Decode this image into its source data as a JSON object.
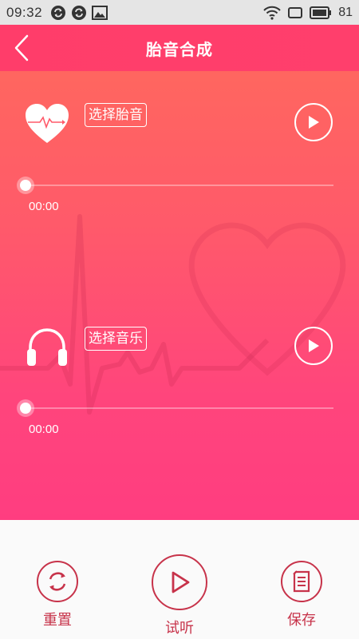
{
  "status_bar": {
    "time": "09:32",
    "battery": "81",
    "icons": [
      "sync-icon",
      "sync-icon",
      "image-icon",
      "wifi-icon",
      "screen-icon",
      "battery-icon"
    ]
  },
  "header": {
    "title": "胎音合成",
    "back_icon": "chevron-left-icon"
  },
  "tracks": [
    {
      "icon": "heart-pulse-icon",
      "select_label": "选择胎音",
      "play_icon": "play-icon",
      "time": "00:00",
      "progress": 0
    },
    {
      "icon": "headphones-icon",
      "select_label": "选择音乐",
      "play_icon": "play-icon",
      "time": "00:00",
      "progress": 0
    }
  ],
  "bottom_actions": [
    {
      "label": "重置",
      "icon": "refresh-icon"
    },
    {
      "label": "试听",
      "icon": "play-outline-icon"
    },
    {
      "label": "保存",
      "icon": "document-icon"
    }
  ],
  "colors": {
    "header": "#ff3d6a",
    "gradient_top": "#ff6a5c",
    "gradient_bottom": "#ff3d80",
    "accent": "#c7334a",
    "status_bar": "#e5e5e5"
  }
}
